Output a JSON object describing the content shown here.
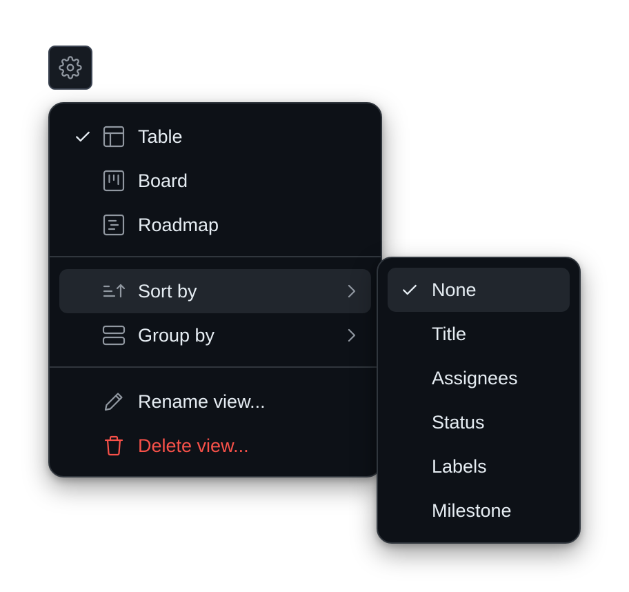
{
  "colors": {
    "menu_bg": "#0d1117",
    "menu_border": "#30363d",
    "text": "#e6edf3",
    "muted_icon": "#9198a1",
    "active_bg": "#21262d",
    "danger": "#f85149"
  },
  "settings_button": {
    "icon": "gear-icon"
  },
  "view_menu": {
    "layouts": [
      {
        "label": "Table",
        "icon": "table-icon",
        "checked": true
      },
      {
        "label": "Board",
        "icon": "board-icon",
        "checked": false
      },
      {
        "label": "Roadmap",
        "icon": "roadmap-icon",
        "checked": false
      }
    ],
    "sort_by": {
      "label": "Sort by",
      "icon": "sort-icon"
    },
    "group_by": {
      "label": "Group by",
      "icon": "group-icon"
    },
    "rename": {
      "label": "Rename view...",
      "icon": "pencil-icon"
    },
    "delete": {
      "label": "Delete view...",
      "icon": "trash-icon"
    }
  },
  "sort_submenu": {
    "options": [
      {
        "label": "None",
        "checked": true
      },
      {
        "label": "Title",
        "checked": false
      },
      {
        "label": "Assignees",
        "checked": false
      },
      {
        "label": "Status",
        "checked": false
      },
      {
        "label": "Labels",
        "checked": false
      },
      {
        "label": "Milestone",
        "checked": false
      }
    ]
  }
}
